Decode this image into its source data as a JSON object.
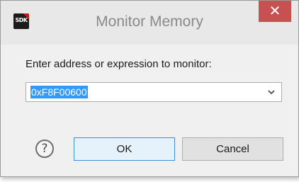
{
  "dialog": {
    "title": "Monitor Memory",
    "app_icon_text": "SDK",
    "close_glyph": "✕",
    "prompt": "Enter address or expression to monitor:",
    "expression_value": "0xF8F00600",
    "help_glyph": "?",
    "ok_label": "OK",
    "cancel_label": "Cancel"
  },
  "colors": {
    "close_button": "#c75050",
    "selection": "#3399ff",
    "default_button_border": "#3c8fd6",
    "dialog_background": "#f0f0f0"
  },
  "icons": [
    "sdk-app-icon",
    "close-icon",
    "chevron-down-icon",
    "help-icon"
  ]
}
